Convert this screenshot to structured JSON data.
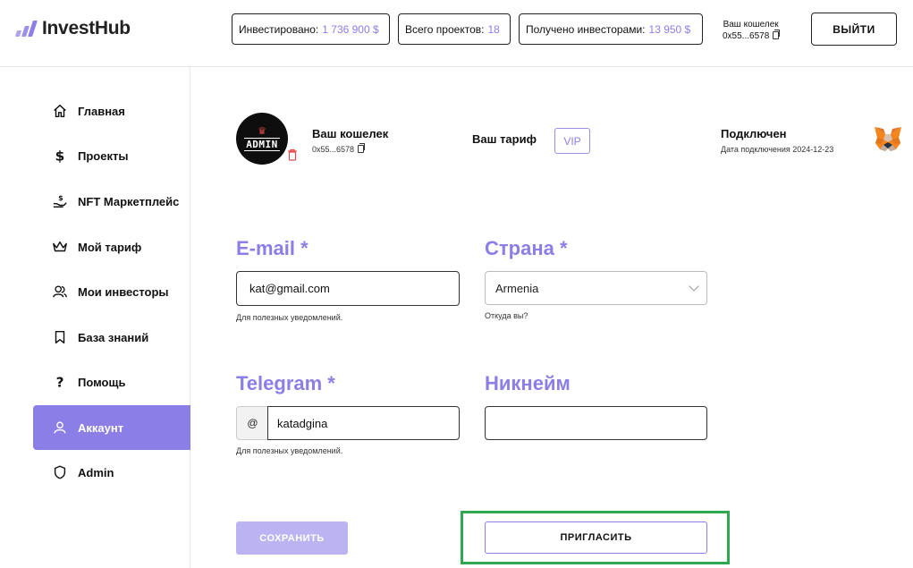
{
  "header": {
    "logo_text": "InvestHub",
    "stats": [
      {
        "label": "Инвестировано:",
        "value": "1 736 900 $"
      },
      {
        "label": "Всего проектов:",
        "value": "18"
      },
      {
        "label": "Получено инвесторами:",
        "value": "13 950 $"
      }
    ],
    "wallet_label": "Ваш кошелек",
    "wallet_address": "0x55...6578",
    "logout_label": "ВЫЙТИ"
  },
  "sidebar": {
    "items": [
      {
        "label": "Главная",
        "icon": "home-icon"
      },
      {
        "label": "Проекты",
        "icon": "dollar-icon"
      },
      {
        "label": "NFT Маркетплейс",
        "icon": "hand-coin-icon"
      },
      {
        "label": "Мой тариф",
        "icon": "crown-icon"
      },
      {
        "label": "Мои инвесторы",
        "icon": "users-icon"
      },
      {
        "label": "База знаний",
        "icon": "bookmark-icon"
      },
      {
        "label": "Помощь",
        "icon": "question-icon"
      },
      {
        "label": "Аккаунт",
        "icon": "user-icon",
        "active": true
      },
      {
        "label": "Admin",
        "icon": "shield-icon"
      }
    ]
  },
  "profile": {
    "avatar_text": "ADMIN",
    "wallet_title": "Ваш кошелек",
    "wallet_address": "0x55...6578",
    "tariff_title": "Ваш тариф",
    "tariff_value": "VIP",
    "status_title": "Подключен",
    "connect_date": "Дата подключения 2024-12-23"
  },
  "form": {
    "email": {
      "label": "E-mail *",
      "value": "kat@gmail.com",
      "help": "Для полезных уведомлений."
    },
    "country": {
      "label": "Страна *",
      "value": "Armenia",
      "help": "Откуда вы?"
    },
    "telegram": {
      "label": "Telegram *",
      "prefix": "@",
      "value": "katadgina",
      "help": "Для полезных уведомлений."
    },
    "nickname": {
      "label": "Никнейм",
      "value": ""
    },
    "save_label": "СОХРАНИТЬ",
    "invite_label": "ПРИГЛАСИТЬ"
  },
  "colors": {
    "accent": "#8b7ee6",
    "highlight": "#2fa84f",
    "danger": "#e24a4a"
  }
}
